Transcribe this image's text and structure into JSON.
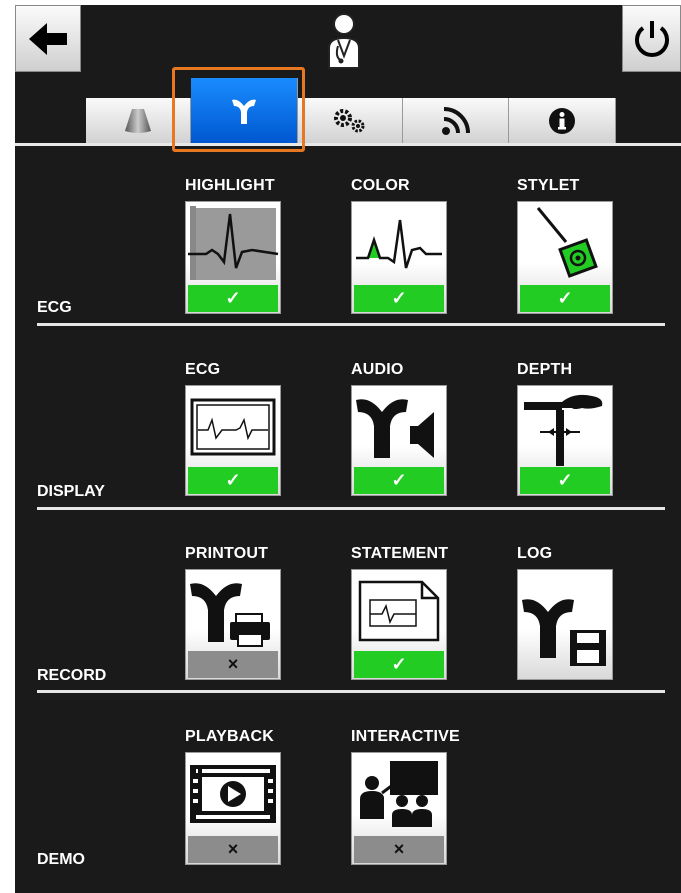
{
  "header": {
    "back_icon": "arrow-left-icon",
    "user_icon": "doctor-icon",
    "power_icon": "power-icon"
  },
  "tabs": [
    {
      "name": "tab-probe",
      "icon": "probe-icon",
      "active": false
    },
    {
      "name": "tab-tip",
      "icon": "tip-icon",
      "active": true
    },
    {
      "name": "tab-settings",
      "icon": "gears-icon",
      "active": false
    },
    {
      "name": "tab-signal",
      "icon": "signal-icon",
      "active": false
    },
    {
      "name": "tab-info",
      "icon": "info-icon",
      "active": false
    }
  ],
  "sections": [
    {
      "label": "ECG",
      "tiles": [
        {
          "label": "HIGHLIGHT",
          "icon": "ecg-highlight-icon",
          "state": "on",
          "mark": "✓"
        },
        {
          "label": "COLOR",
          "icon": "ecg-color-icon",
          "state": "on",
          "mark": "✓"
        },
        {
          "label": "STYLET",
          "icon": "stylet-icon",
          "state": "on",
          "mark": "✓"
        }
      ]
    },
    {
      "label": "DISPLAY",
      "tiles": [
        {
          "label": "ECG",
          "icon": "ecg-display-icon",
          "state": "on",
          "mark": "✓"
        },
        {
          "label": "AUDIO",
          "icon": "audio-icon",
          "state": "on",
          "mark": "✓"
        },
        {
          "label": "DEPTH",
          "icon": "depth-icon",
          "state": "on",
          "mark": "✓"
        }
      ]
    },
    {
      "label": "RECORD",
      "tiles": [
        {
          "label": "PRINTOUT",
          "icon": "printer-icon",
          "state": "off",
          "mark": "×"
        },
        {
          "label": "STATEMENT",
          "icon": "statement-icon",
          "state": "on",
          "mark": "✓"
        },
        {
          "label": "LOG",
          "icon": "save-log-icon",
          "state": "none",
          "mark": ""
        }
      ]
    },
    {
      "label": "DEMO",
      "tiles": [
        {
          "label": "PLAYBACK",
          "icon": "playback-icon",
          "state": "off",
          "mark": "×"
        },
        {
          "label": "INTERACTIVE",
          "icon": "interactive-icon",
          "state": "off",
          "mark": "×"
        }
      ]
    }
  ],
  "colors": {
    "accent_active_tab": "#0a72ee",
    "highlight_border": "#e87722",
    "badge_on": "#22cc22",
    "badge_off": "#8c8c8c",
    "background": "#1a1a1a"
  }
}
